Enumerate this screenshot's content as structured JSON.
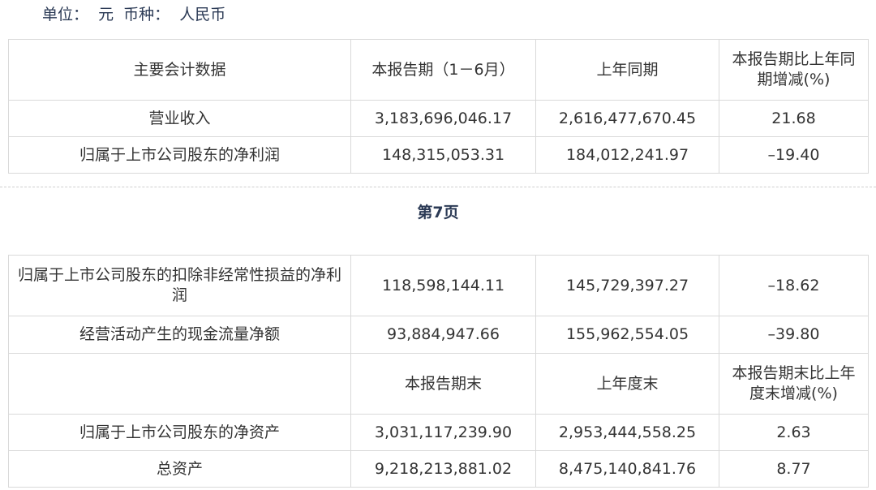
{
  "unit_line": "单位：  元  币种：  人民币",
  "page_label": "第7页",
  "table1": {
    "headers": [
      "主要会计数据",
      "本报告期（1－6月）",
      "上年同期",
      "本报告期比上年同期增减(%)"
    ],
    "rows": [
      [
        "营业收入",
        "3,183,696,046.17",
        "2,616,477,670.45",
        "21.68"
      ],
      [
        "归属于上市公司股东的净利润",
        "148,315,053.31",
        "184,012,241.97",
        "–19.40"
      ]
    ]
  },
  "table2": {
    "rows": [
      [
        "归属于上市公司股东的扣除非经常性损益的净利润",
        "118,598,144.11",
        "145,729,397.27",
        "–18.62"
      ],
      [
        "经营活动产生的现金流量净额",
        "93,884,947.66",
        "155,962,554.05",
        "–39.80"
      ]
    ],
    "subheader": [
      "",
      "本报告期末",
      "上年度末",
      "本报告期末比上年度末增减(%)"
    ],
    "rows_end": [
      [
        "归属于上市公司股东的净资产",
        "3,031,117,239.90",
        "2,953,444,558.25",
        "2.63"
      ],
      [
        "总资产",
        "9,218,213,881.02",
        "8,475,140,841.76",
        "8.77"
      ]
    ]
  }
}
